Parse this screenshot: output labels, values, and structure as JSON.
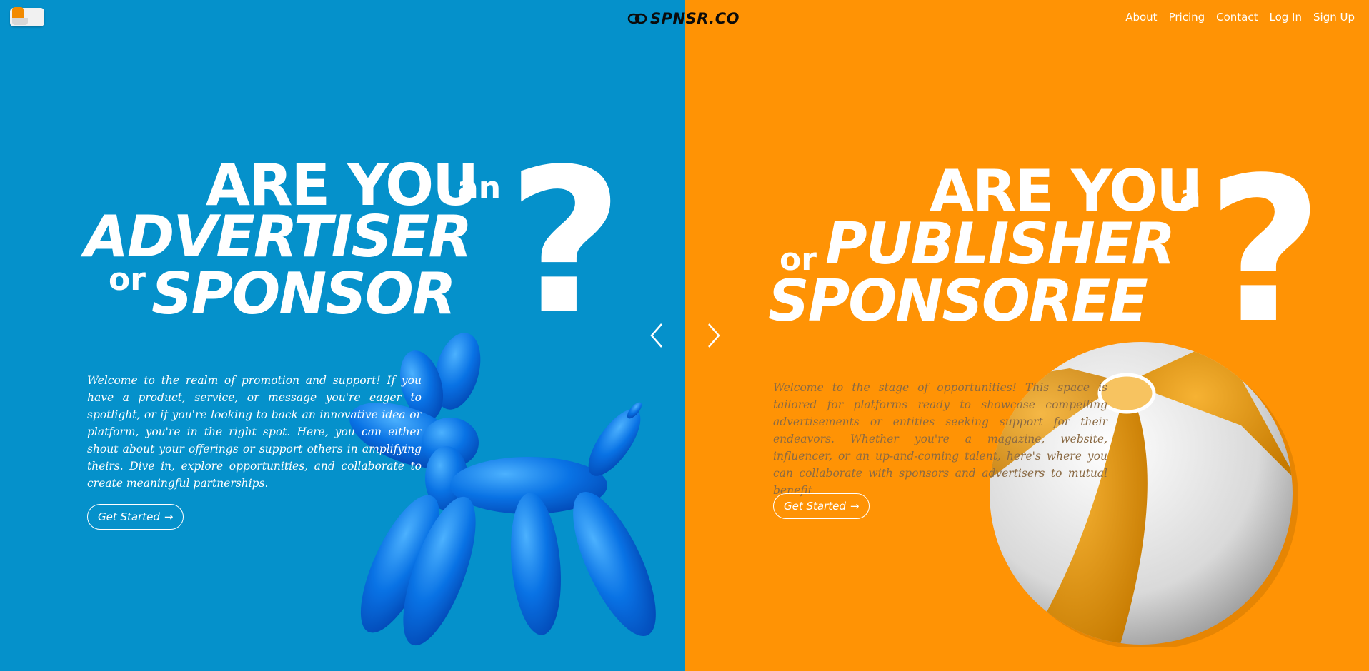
{
  "brand": {
    "logo_text": "SPNSR.CO"
  },
  "nav": {
    "items": [
      {
        "label": "About"
      },
      {
        "label": "Pricing"
      },
      {
        "label": "Contact"
      },
      {
        "label": "Log In"
      },
      {
        "label": "Sign Up"
      }
    ]
  },
  "colors": {
    "left_bg": "#0591CB",
    "right_bg": "#FF9305"
  },
  "left": {
    "headline_line1": "ARE YOU",
    "headline_article": "an",
    "headline_line2": "ADVERTISER",
    "headline_or": "or",
    "headline_line3": "SPONSOR",
    "question_mark": "?",
    "description": "Welcome to the realm of promotion and support! If you have a product, service, or message you're eager to spotlight, or if you're looking to back an innovative idea or platform, you're in the right spot. Here, you can either shout about your offerings or support others in amplifying theirs. Dive in, explore opportunities, and collaborate to create meaningful partnerships.",
    "cta_label": "Get Started",
    "illustration": "balloon-dog"
  },
  "right": {
    "headline_line1": "ARE YOU",
    "headline_article": "a",
    "headline_or": "or",
    "headline_line2": "PUBLISHER",
    "headline_line3": "SPONSOREE",
    "question_mark": "?",
    "description": "Welcome to the stage of opportunities! This space is tailored for platforms ready to showcase compelling advertisements or entities seeking support for their endeavors. Whether you're a magazine, website, influencer, or an up-and-coming talent, here's where you can collaborate with sponsors and advertisers to mutual benefit.",
    "cta_label": "Get Started",
    "illustration": "beach-ball"
  },
  "icons": {
    "toggle": "theme-toggle-icon",
    "logo": "bee-logo-icon",
    "prev": "chevron-left-icon",
    "next": "chevron-right-icon",
    "cta_arrow": "arrow-right-icon"
  }
}
